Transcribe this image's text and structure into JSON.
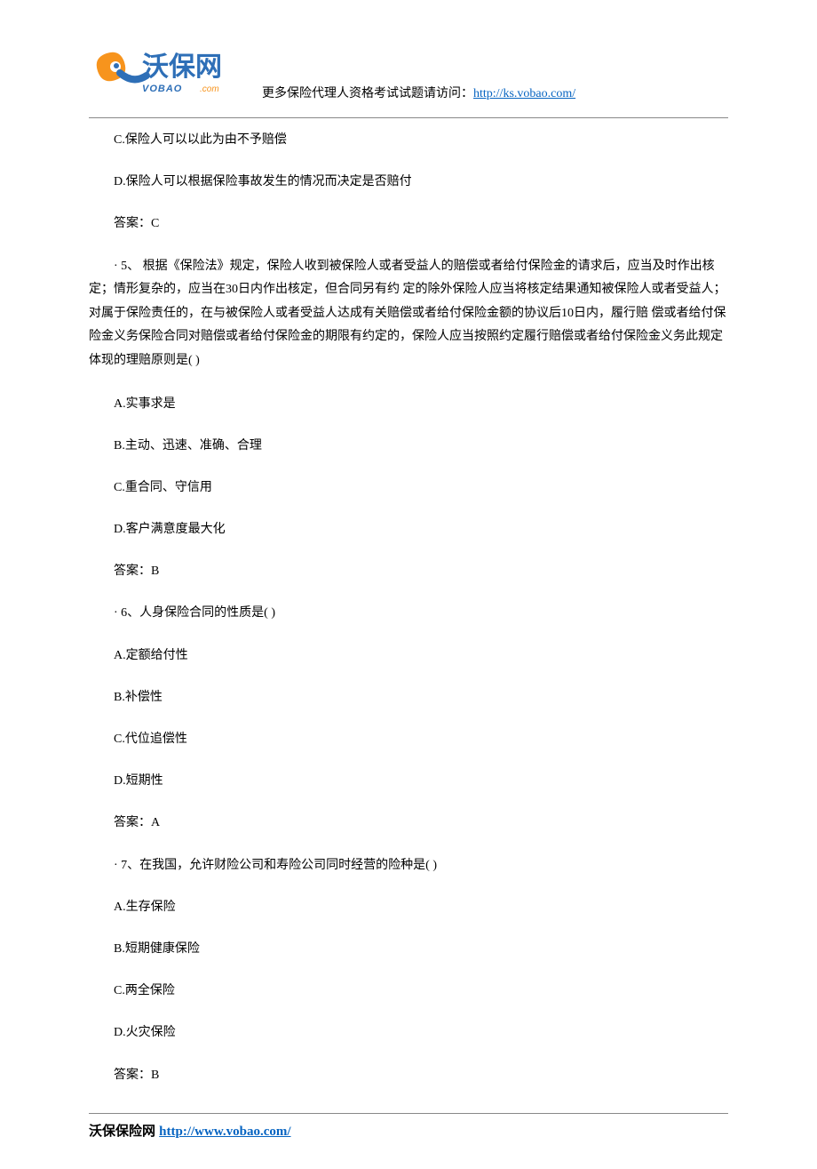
{
  "header": {
    "text_prefix": "更多保险代理人资格考试试题请访问：",
    "link": "http://ks.vobao.com/"
  },
  "content": {
    "p1": "C.保险人可以以此为由不予赔偿",
    "p2": "D.保险人可以根据保险事故发生的情况而决定是否赔付",
    "p3": "答案：C",
    "q5": "· 5、 根据《保险法》规定，保险人收到被保险人或者受益人的赔偿或者给付保险金的请求后，应当及时作出核定；情形复杂的，应当在30日内作出核定，但合同另有约 定的除外保险人应当将核定结果通知被保险人或者受益人；对属于保险责任的，在与被保险人或者受益人达成有关赔偿或者给付保险金额的协议后10日内，履行赔 偿或者给付保险金义务保险合同对赔偿或者给付保险金的期限有约定的，保险人应当按照约定履行赔偿或者给付保险金义务此规定体现的理赔原则是(  )",
    "q5a": "A.实事求是",
    "q5b": "B.主动、迅速、准确、合理",
    "q5c": "C.重合同、守信用",
    "q5d": "D.客户满意度最大化",
    "q5ans": "答案：B",
    "q6": "· 6、人身保险合同的性质是(  )",
    "q6a": "A.定额给付性",
    "q6b": "B.补偿性",
    "q6c": "C.代位追偿性",
    "q6d": "D.短期性",
    "q6ans": "答案：A",
    "q7": "· 7、在我国，允许财险公司和寿险公司同时经营的险种是(  )",
    "q7a": "A.生存保险",
    "q7b": "B.短期健康保险",
    "q7c": "C.两全保险",
    "q7d": "D.火灾保险",
    "q7ans": "答案：B"
  },
  "footer": {
    "text_prefix": "沃保保险网 ",
    "link": "http://www.vobao.com/"
  }
}
